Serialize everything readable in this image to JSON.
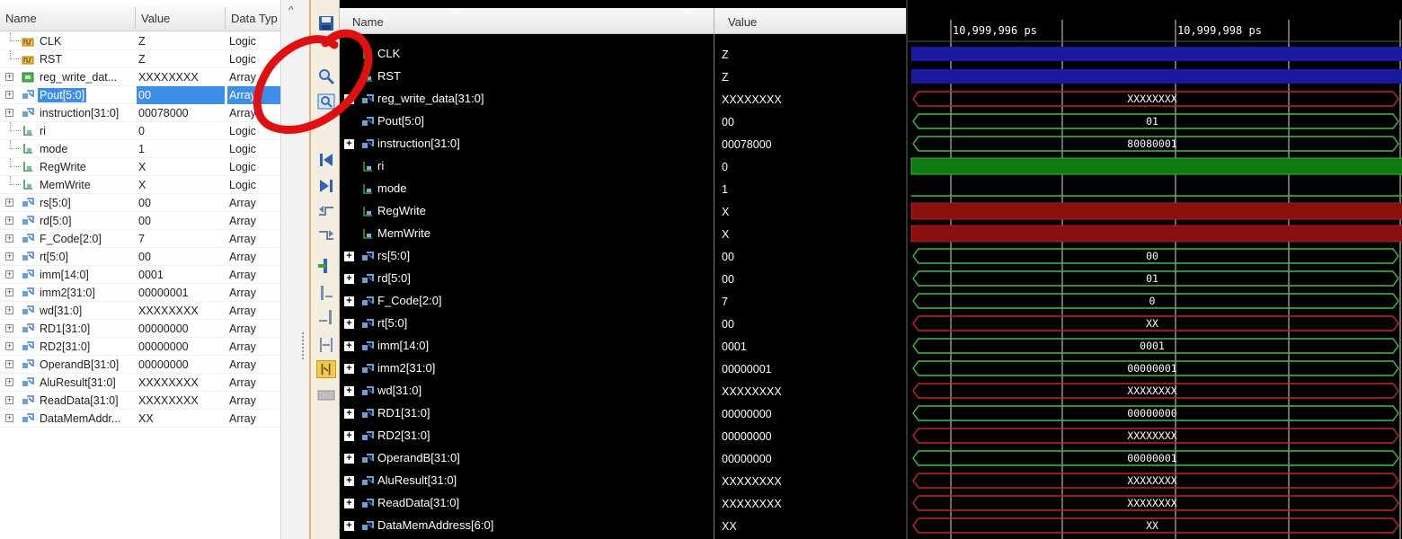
{
  "objects_panel": {
    "headers": {
      "name": "Name",
      "value": "Value",
      "type": "Data Typ"
    },
    "rows": [
      {
        "name": "CLK",
        "value": "Z",
        "type": "Logic",
        "kind": "clock",
        "expandable": false,
        "selected": false
      },
      {
        "name": "RST",
        "value": "Z",
        "type": "Logic",
        "kind": "clock",
        "expandable": false,
        "selected": false
      },
      {
        "name": "reg_write_dat...",
        "value": "XXXXXXXX",
        "type": "Array",
        "kind": "green-array",
        "expandable": true,
        "selected": false
      },
      {
        "name": "Pout[5:0]",
        "value": "00",
        "type": "Array",
        "kind": "array",
        "expandable": true,
        "selected": true
      },
      {
        "name": "instruction[31:0]",
        "value": "00078000",
        "type": "Array",
        "kind": "array",
        "expandable": true,
        "selected": false
      },
      {
        "name": "ri",
        "value": "0",
        "type": "Logic",
        "kind": "logic",
        "expandable": false,
        "selected": false
      },
      {
        "name": "mode",
        "value": "1",
        "type": "Logic",
        "kind": "logic",
        "expandable": false,
        "selected": false
      },
      {
        "name": "RegWrite",
        "value": "X",
        "type": "Logic",
        "kind": "logic",
        "expandable": false,
        "selected": false
      },
      {
        "name": "MemWrite",
        "value": "X",
        "type": "Logic",
        "kind": "logic",
        "expandable": false,
        "selected": false
      },
      {
        "name": "rs[5:0]",
        "value": "00",
        "type": "Array",
        "kind": "array",
        "expandable": true,
        "selected": false
      },
      {
        "name": "rd[5:0]",
        "value": "00",
        "type": "Array",
        "kind": "array",
        "expandable": true,
        "selected": false
      },
      {
        "name": "F_Code[2:0]",
        "value": "7",
        "type": "Array",
        "kind": "array",
        "expandable": true,
        "selected": false
      },
      {
        "name": "rt[5:0]",
        "value": "00",
        "type": "Array",
        "kind": "array",
        "expandable": true,
        "selected": false
      },
      {
        "name": "imm[14:0]",
        "value": "0001",
        "type": "Array",
        "kind": "array",
        "expandable": true,
        "selected": false
      },
      {
        "name": "imm2[31:0]",
        "value": "00000001",
        "type": "Array",
        "kind": "array",
        "expandable": true,
        "selected": false
      },
      {
        "name": "wd[31:0]",
        "value": "XXXXXXXX",
        "type": "Array",
        "kind": "array",
        "expandable": true,
        "selected": false
      },
      {
        "name": "RD1[31:0]",
        "value": "00000000",
        "type": "Array",
        "kind": "array",
        "expandable": true,
        "selected": false
      },
      {
        "name": "RD2[31:0]",
        "value": "00000000",
        "type": "Array",
        "kind": "array",
        "expandable": true,
        "selected": false
      },
      {
        "name": "OperandB[31:0]",
        "value": "00000000",
        "type": "Array",
        "kind": "array",
        "expandable": true,
        "selected": false
      },
      {
        "name": "AluResult[31:0]",
        "value": "XXXXXXXX",
        "type": "Array",
        "kind": "array",
        "expandable": true,
        "selected": false
      },
      {
        "name": "ReadData[31:0]",
        "value": "XXXXXXXX",
        "type": "Array",
        "kind": "array",
        "expandable": true,
        "selected": false
      },
      {
        "name": "DataMemAddr...",
        "value": "XX",
        "type": "Array",
        "kind": "array",
        "expandable": true,
        "selected": false
      }
    ]
  },
  "toolbar": {
    "icons": [
      "save-icon",
      "zoom-icon",
      "zoom-fit-icon",
      "goto-start-icon",
      "goto-end-icon",
      "prev-transition-icon",
      "next-transition-icon",
      "add-marker-icon",
      "prev-marker-icon",
      "next-marker-icon",
      "swap-cursor-icon",
      "snap-icon",
      "grid-icon"
    ]
  },
  "wave_panel": {
    "headers": {
      "name": "Name",
      "value": "Value"
    },
    "signals": [
      {
        "name": "CLK",
        "value": "Z",
        "kind": "logic",
        "expandable": false,
        "wave": {
          "type": "bus-z",
          "color": "#1a1aa0"
        }
      },
      {
        "name": "RST",
        "value": "Z",
        "kind": "logic",
        "expandable": false,
        "wave": {
          "type": "bus-z",
          "color": "#1a1aa0"
        }
      },
      {
        "name": "reg_write_data[31:0]",
        "value": "XXXXXXXX",
        "kind": "array",
        "expandable": true,
        "wave": {
          "type": "bus",
          "color": "#c62828",
          "text": "XXXXXXXX"
        }
      },
      {
        "name": "Pout[5:0]",
        "value": "00",
        "kind": "array",
        "expandable": false,
        "wave": {
          "type": "bus",
          "color": "#3fbf3f",
          "text": "01"
        }
      },
      {
        "name": "instruction[31:0]",
        "value": "00078000",
        "kind": "array",
        "expandable": true,
        "wave": {
          "type": "bus",
          "color": "#3fbf3f",
          "text": "80080001"
        }
      },
      {
        "name": "ri",
        "value": "0",
        "kind": "logic",
        "expandable": false,
        "wave": {
          "type": "solid",
          "color": "#0f7a0f"
        }
      },
      {
        "name": "mode",
        "value": "1",
        "kind": "logic",
        "expandable": false,
        "wave": {
          "type": "line",
          "color": "#3fbf3f"
        }
      },
      {
        "name": "RegWrite",
        "value": "X",
        "kind": "logic",
        "expandable": false,
        "wave": {
          "type": "solid",
          "color": "#8a1010"
        }
      },
      {
        "name": "MemWrite",
        "value": "X",
        "kind": "logic",
        "expandable": false,
        "wave": {
          "type": "solid",
          "color": "#8a1010"
        }
      },
      {
        "name": "rs[5:0]",
        "value": "00",
        "kind": "array",
        "expandable": true,
        "wave": {
          "type": "bus",
          "color": "#3fbf3f",
          "text": "00"
        }
      },
      {
        "name": "rd[5:0]",
        "value": "00",
        "kind": "array",
        "expandable": true,
        "wave": {
          "type": "bus",
          "color": "#3fbf3f",
          "text": "01"
        }
      },
      {
        "name": "F_Code[2:0]",
        "value": "7",
        "kind": "array",
        "expandable": true,
        "wave": {
          "type": "bus",
          "color": "#3fbf3f",
          "text": "0"
        }
      },
      {
        "name": "rt[5:0]",
        "value": "00",
        "kind": "array",
        "expandable": true,
        "wave": {
          "type": "bus",
          "color": "#c62828",
          "text": "XX"
        }
      },
      {
        "name": "imm[14:0]",
        "value": "0001",
        "kind": "array",
        "expandable": true,
        "wave": {
          "type": "bus",
          "color": "#3fbf3f",
          "text": "0001"
        }
      },
      {
        "name": "imm2[31:0]",
        "value": "00000001",
        "kind": "array",
        "expandable": true,
        "wave": {
          "type": "bus",
          "color": "#3fbf3f",
          "text": "00000001"
        }
      },
      {
        "name": "wd[31:0]",
        "value": "XXXXXXXX",
        "kind": "array",
        "expandable": true,
        "wave": {
          "type": "bus",
          "color": "#c62828",
          "text": "XXXXXXXX"
        }
      },
      {
        "name": "RD1[31:0]",
        "value": "00000000",
        "kind": "array",
        "expandable": true,
        "wave": {
          "type": "bus",
          "color": "#3fbf3f",
          "text": "00000000"
        }
      },
      {
        "name": "RD2[31:0]",
        "value": "00000000",
        "kind": "array",
        "expandable": true,
        "wave": {
          "type": "bus",
          "color": "#c62828",
          "text": "XXXXXXXX"
        }
      },
      {
        "name": "OperandB[31:0]",
        "value": "00000000",
        "kind": "array",
        "expandable": true,
        "wave": {
          "type": "bus",
          "color": "#3fbf3f",
          "text": "00000001"
        }
      },
      {
        "name": "AluResult[31:0]",
        "value": "XXXXXXXX",
        "kind": "array",
        "expandable": true,
        "wave": {
          "type": "bus",
          "color": "#c62828",
          "text": "XXXXXXXX"
        }
      },
      {
        "name": "ReadData[31:0]",
        "value": "XXXXXXXX",
        "kind": "array",
        "expandable": true,
        "wave": {
          "type": "bus",
          "color": "#c62828",
          "text": "XXXXXXXX"
        }
      },
      {
        "name": "DataMemAddress[6:0]",
        "value": "XX",
        "kind": "array",
        "expandable": true,
        "wave": {
          "type": "bus",
          "color": "#c62828",
          "text": "XX"
        }
      }
    ]
  },
  "timeline": {
    "markers": [
      "10,999,996 ps",
      "10,999,998 ps"
    ]
  },
  "colors": {
    "selection": "#3d8ee6",
    "bus_valid": "#3fbf3f",
    "bus_unknown": "#c62828",
    "high_z": "#1a1aa0",
    "annotation": "#e01010"
  }
}
